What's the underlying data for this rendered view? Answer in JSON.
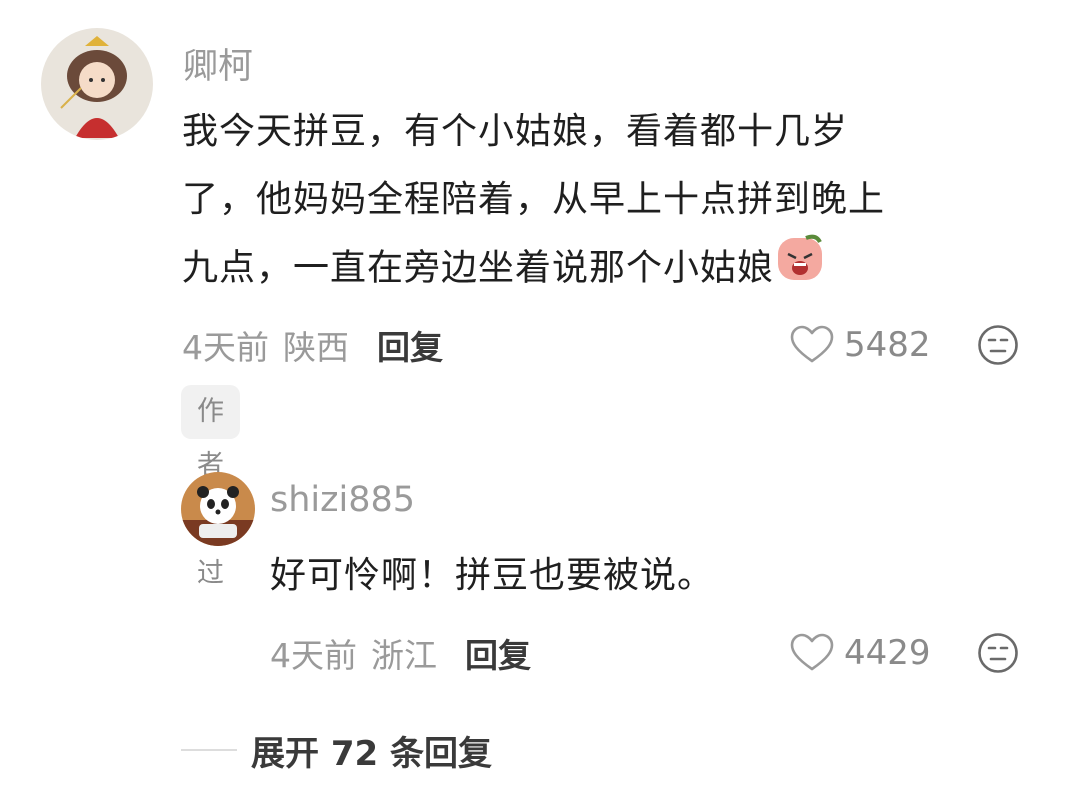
{
  "comments": [
    {
      "username": "卿柯",
      "lines": [
        "我今天拼豆，有个小姑娘，看着都十几岁",
        "了，他妈妈全程陪着，从早上十点拼到晚上",
        "九点，一直在旁边坐着说那个小姑娘"
      ],
      "emoji": "crying-emoji-icon",
      "time": "4天前",
      "region": "陕西",
      "reply_label": "回复",
      "likes": "5482",
      "badge": "作者赞过"
    },
    {
      "username": "shizi885",
      "lines": [
        "好可怜啊！拼豆也要被说。"
      ],
      "time": "4天前",
      "region": "浙江",
      "reply_label": "回复",
      "likes": "4429"
    }
  ],
  "expand_label": "展开 72 条回复",
  "colors": {
    "text": "#1f1f1f",
    "muted": "#9a9a9a",
    "badge_bg": "#f1f1f1"
  }
}
